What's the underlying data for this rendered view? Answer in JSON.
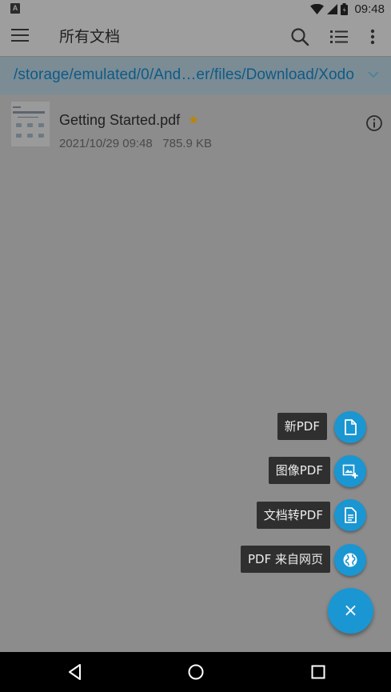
{
  "status": {
    "left_icon_glyph": "A",
    "time": "09:48",
    "icons": [
      "wifi-icon",
      "signal-icon",
      "battery-icon"
    ]
  },
  "app_bar": {
    "title": "所有文档",
    "icons": [
      "menu-icon",
      "search-icon",
      "list-view-icon",
      "more-vert-icon"
    ]
  },
  "path_bar": {
    "path": "/storage/emulated/0/And…er/files/Download/Xodo",
    "text_color": "#0f5a87"
  },
  "files": [
    {
      "name": "Getting Started.pdf",
      "starred": true,
      "star_glyph": "★",
      "date": "2021/10/29 09:48",
      "size": "785.9 KB",
      "meta": "2021/10/29 09:48   785.9 KB"
    }
  ],
  "fab_menu": {
    "items": [
      {
        "label": "新PDF",
        "icon": "new-file-icon"
      },
      {
        "label": "图像PDF",
        "icon": "image-add-icon"
      },
      {
        "label": "文档转PDF",
        "icon": "document-icon"
      },
      {
        "label": "PDF 来自网页",
        "icon": "globe-icon"
      }
    ],
    "close_glyph": "×",
    "accent_color": "#1a96d2"
  },
  "nav_bar": {
    "buttons": [
      "back-icon",
      "home-icon",
      "recents-icon"
    ]
  }
}
